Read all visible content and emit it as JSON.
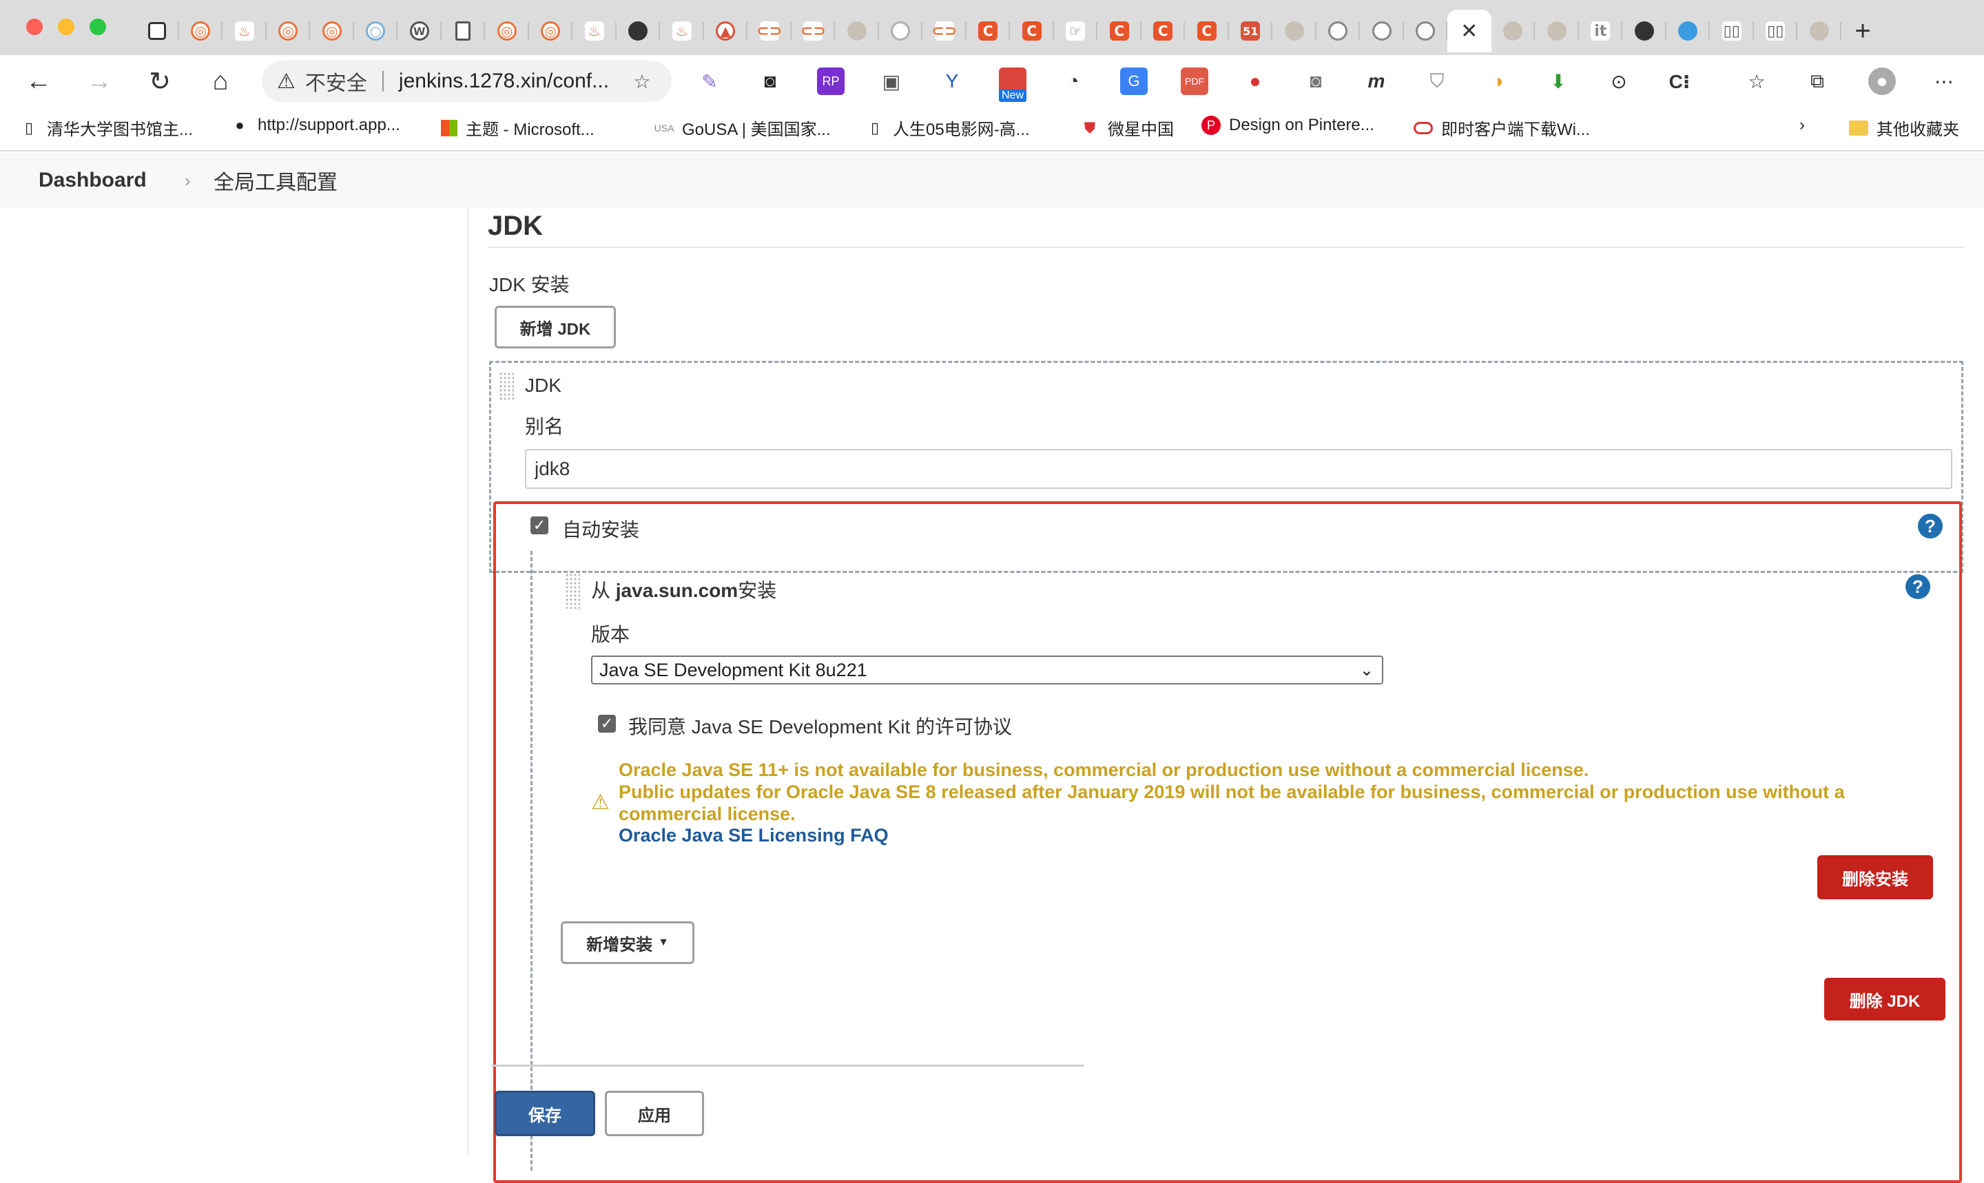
{
  "browser": {
    "url_warning": "不安全",
    "url": "jenkins.1278.xin/conf...",
    "close_tab_glyph": "✕",
    "new_tab_glyph": "+",
    "ext_new_badge": "New",
    "colors": {
      "chrome": "#dcdcdc",
      "accent_orange": "#e8542a",
      "github": "#333333"
    }
  },
  "bookmarks": [
    {
      "label": "清华大学图书馆主...",
      "icon": "document-icon"
    },
    {
      "label": "http://support.app...",
      "icon": "apple-icon"
    },
    {
      "label": "主题 - Microsoft...",
      "icon": "microsoft-icon"
    },
    {
      "label": "GoUSA | 美国国家...",
      "icon": "usa-icon"
    },
    {
      "label": "人生05电影网-高...",
      "icon": "document-icon"
    },
    {
      "label": "微星中国",
      "icon": "shield-icon"
    },
    {
      "label": "Design on Pintere...",
      "icon": "pinterest-icon"
    },
    {
      "label": "即时客户端下载Wi...",
      "icon": "oracle-icon"
    }
  ],
  "bookmarks_other": "其他收藏夹",
  "breadcrumb": {
    "home": "Dashboard",
    "separator": "›",
    "current": "全局工具配置"
  },
  "jdk_section": {
    "title": "JDK",
    "install_label": "JDK 安装",
    "add_jdk_button": "新增 JDK",
    "item_title": "JDK",
    "alias_label": "别名",
    "alias_value": "jdk8",
    "auto_install_label": "自动安装",
    "auto_install_checked": true,
    "installer_title_prefix": "从 ",
    "installer_title_bold": "java.sun.com",
    "installer_title_suffix": "安装",
    "version_label": "版本",
    "version_selected": "Java SE Development Kit 8u221",
    "agree_label": "我同意 Java SE Development Kit 的许可协议",
    "agree_checked": true,
    "warning_line1": "Oracle Java SE 11+ is not available for business, commercial or production use without a commercial license.",
    "warning_line2": "Public updates for Oracle Java SE 8 released after January 2019 will not be available for business, commercial or production use without a",
    "warning_line3": "commercial license.",
    "faq_link": "Oracle Java SE Licensing FAQ",
    "delete_install_button": "删除安装",
    "add_install_button": "新增安装",
    "delete_jdk_button": "删除 JDK",
    "help_glyph": "?",
    "check_glyph": "✓",
    "warning_glyph": "⚠"
  },
  "footer_buttons": {
    "save": "保存",
    "apply": "应用"
  }
}
